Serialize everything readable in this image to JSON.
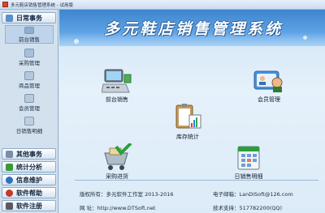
{
  "window": {
    "title": "多元鞋店销售管理系统 - 试用版"
  },
  "banner": {
    "title": "多元鞋店销售管理系统"
  },
  "sidebar": {
    "active_section": "日常事务",
    "items": [
      {
        "label": "前台销售",
        "icon": "computer-icon",
        "color": "#8cb0d4"
      },
      {
        "label": "采购管理",
        "icon": "cart-icon",
        "color": "#a7bfd8"
      },
      {
        "label": "商品管理",
        "icon": "shoe-box-icon",
        "color": "#b5c7da"
      },
      {
        "label": "会员管理",
        "icon": "member-card-icon",
        "color": "#b9c9d9"
      },
      {
        "label": "日销售明细",
        "icon": "detail-list-icon",
        "color": "#c0cfde"
      }
    ],
    "sections": [
      {
        "label": "其他事务",
        "color": "#7a8fa6"
      },
      {
        "label": "统计分析",
        "color": "#3a9a3a"
      },
      {
        "label": "信息维护",
        "color": "#2d72c2"
      },
      {
        "label": "软件帮助",
        "color": "#c23a2d"
      },
      {
        "label": "软件注册",
        "color": "#5a5a5a"
      }
    ]
  },
  "tiles": {
    "front_sales": {
      "label": "前台销售",
      "icon": "cash-register-icon"
    },
    "member": {
      "label": "会员管理",
      "icon": "member-card-icon"
    },
    "inventory": {
      "label": "库存统计",
      "icon": "clipboard-chart-icon"
    },
    "purchase": {
      "label": "采购进货",
      "icon": "cart-check-icon"
    },
    "daily": {
      "label": "日销售明细",
      "icon": "calendar-list-icon"
    }
  },
  "footer": {
    "copyright": "版权所有：多元软件工作室 2013-2016",
    "email": "电子邮箱：LanDiSoft@126.com",
    "site": "网    址：http://www.DTSoft.net",
    "support": "技术支持：517782200(QQ)"
  },
  "colors": {
    "banner": "#3d85d0",
    "sidebar": "#d3e1ef"
  }
}
